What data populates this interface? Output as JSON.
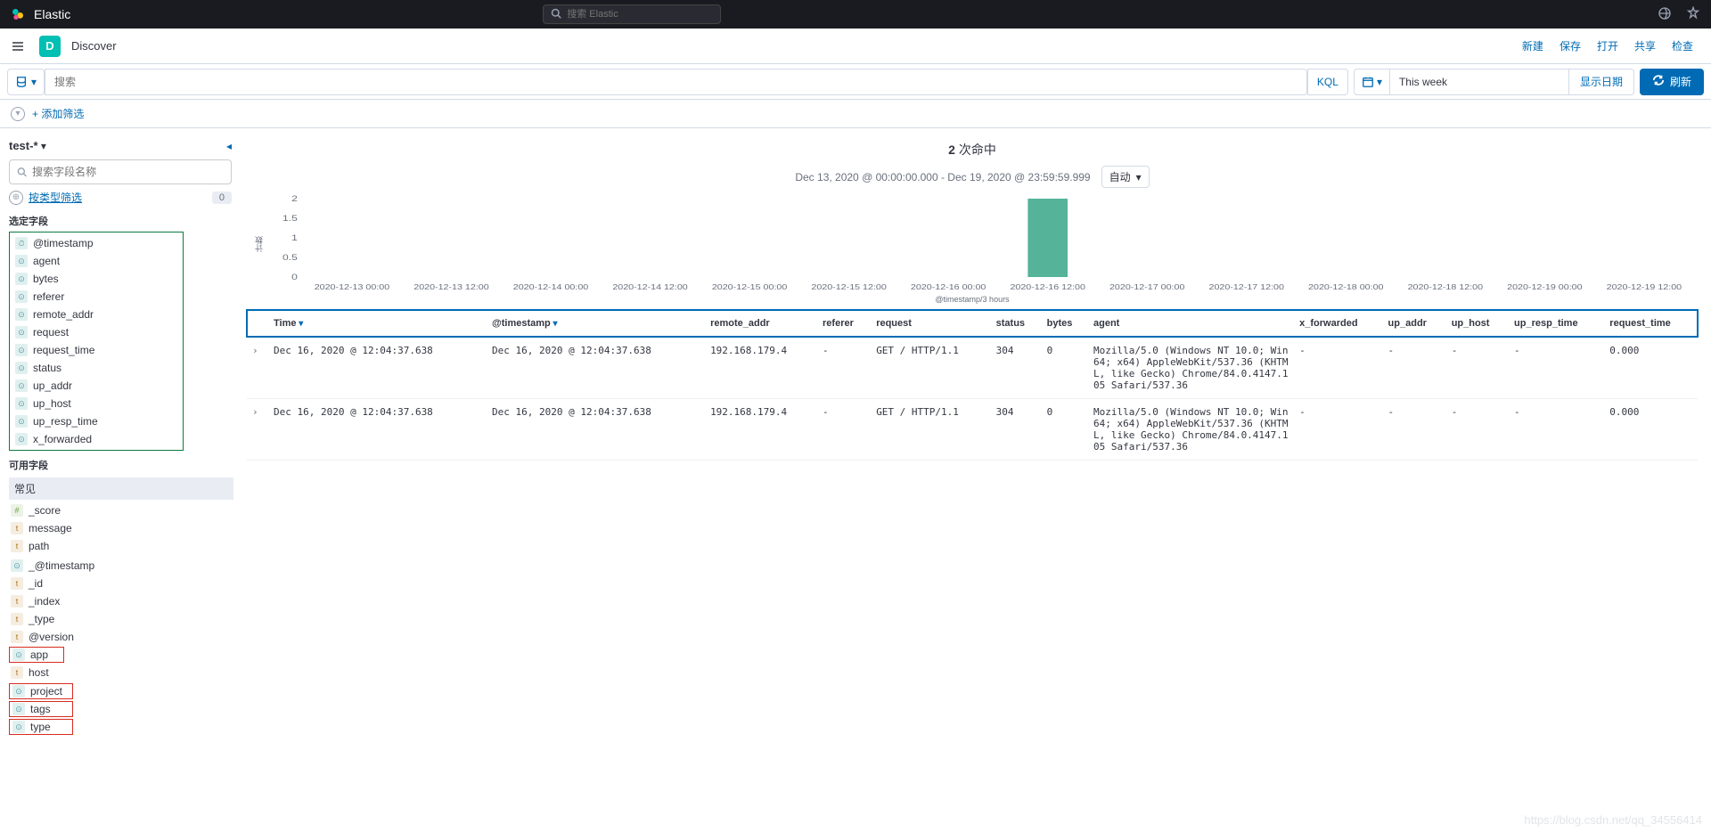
{
  "header": {
    "brand": "Elastic",
    "search_placeholder": "搜索 Elastic"
  },
  "subheader": {
    "badge": "D",
    "title": "Discover",
    "links": {
      "new": "新建",
      "save": "保存",
      "open": "打开",
      "share": "共享",
      "inspect": "检查"
    }
  },
  "querybar": {
    "search_placeholder": "搜索",
    "kql": "KQL",
    "date_text": "This week",
    "show_dates": "显示日期",
    "refresh": "刷新"
  },
  "filterbar": {
    "add": "+ 添加筛选"
  },
  "sidebar": {
    "index_pattern": "test-*",
    "field_search_placeholder": "搜索字段名称",
    "filter_by_type": "按类型筛选",
    "filter_count": "0",
    "selected_label": "选定字段",
    "available_label": "可用字段",
    "popular_label": "常见",
    "selected_fields": [
      "@timestamp",
      "agent",
      "bytes",
      "referer",
      "remote_addr",
      "request",
      "request_time",
      "status",
      "up_addr",
      "up_host",
      "up_resp_time",
      "x_forwarded"
    ],
    "popular_fields": [
      {
        "n": "_score",
        "t": "n"
      },
      {
        "n": "message",
        "t": "t"
      },
      {
        "n": "path",
        "t": "t"
      }
    ],
    "available_fields": [
      {
        "n": "_@timestamp",
        "t": "c"
      },
      {
        "n": "_id",
        "t": "t"
      },
      {
        "n": "_index",
        "t": "t"
      },
      {
        "n": "_type",
        "t": "t"
      },
      {
        "n": "@version",
        "t": "t"
      },
      {
        "n": "app",
        "t": "c",
        "hl": "r"
      },
      {
        "n": "host",
        "t": "t"
      },
      {
        "n": "project",
        "t": "c",
        "hl": "rg"
      },
      {
        "n": "tags",
        "t": "c",
        "hl": "rg"
      },
      {
        "n": "type",
        "t": "c",
        "hl": "rg"
      }
    ]
  },
  "main": {
    "hits_prefix": "2",
    "hits_suffix": " 次命中",
    "range_text": "Dec 13, 2020 @ 00:00:00.000 - Dec 19, 2020 @ 23:59:59.999",
    "interval": "自动",
    "y_axis": "计数",
    "x_axis": "@timestamp/3 hours",
    "columns": [
      "Time",
      "@timestamp",
      "remote_addr",
      "referer",
      "request",
      "status",
      "bytes",
      "agent",
      "x_forwarded",
      "up_addr",
      "up_host",
      "up_resp_time",
      "request_time"
    ],
    "sorted_cols": [
      0,
      1
    ],
    "rows": [
      {
        "time": "Dec 16, 2020 @ 12:04:37.638",
        "ts": "Dec 16, 2020 @ 12:04:37.638",
        "remote": "192.168.179.4",
        "referer": "-",
        "request": "GET / HTTP/1.1",
        "status": "304",
        "bytes": "0",
        "agent": "Mozilla/5.0 (Windows NT 10.0; Win64; x64) AppleWebKit/537.36 (KHTML, like Gecko) Chrome/84.0.4147.105 Safari/537.36",
        "xf": "-",
        "ua": "-",
        "uh": "-",
        "urt": "-",
        "rt": "0.000"
      },
      {
        "time": "Dec 16, 2020 @ 12:04:37.638",
        "ts": "Dec 16, 2020 @ 12:04:37.638",
        "remote": "192.168.179.4",
        "referer": "-",
        "request": "GET / HTTP/1.1",
        "status": "304",
        "bytes": "0",
        "agent": "Mozilla/5.0 (Windows NT 10.0; Win64; x64) AppleWebKit/537.36 (KHTML, like Gecko) Chrome/84.0.4147.105 Safari/537.36",
        "xf": "-",
        "ua": "-",
        "uh": "-",
        "urt": "-",
        "rt": "0.000"
      }
    ]
  },
  "chart_data": {
    "type": "bar",
    "categories": [
      "2020-12-13 00:00",
      "2020-12-13 12:00",
      "2020-12-14 00:00",
      "2020-12-14 12:00",
      "2020-12-15 00:00",
      "2020-12-15 12:00",
      "2020-12-16 00:00",
      "2020-12-16 12:00",
      "2020-12-17 00:00",
      "2020-12-17 12:00",
      "2020-12-18 00:00",
      "2020-12-18 12:00",
      "2020-12-19 00:00",
      "2020-12-19 12:00"
    ],
    "values": [
      0,
      0,
      0,
      0,
      0,
      0,
      0,
      2,
      0,
      0,
      0,
      0,
      0,
      0
    ],
    "y_ticks": [
      0,
      0.5,
      1,
      1.5,
      2
    ],
    "ylim": [
      0,
      2
    ],
    "title": "",
    "xlabel": "@timestamp/3 hours",
    "ylabel": "计数"
  },
  "watermark": "https://blog.csdn.net/qq_34556414"
}
